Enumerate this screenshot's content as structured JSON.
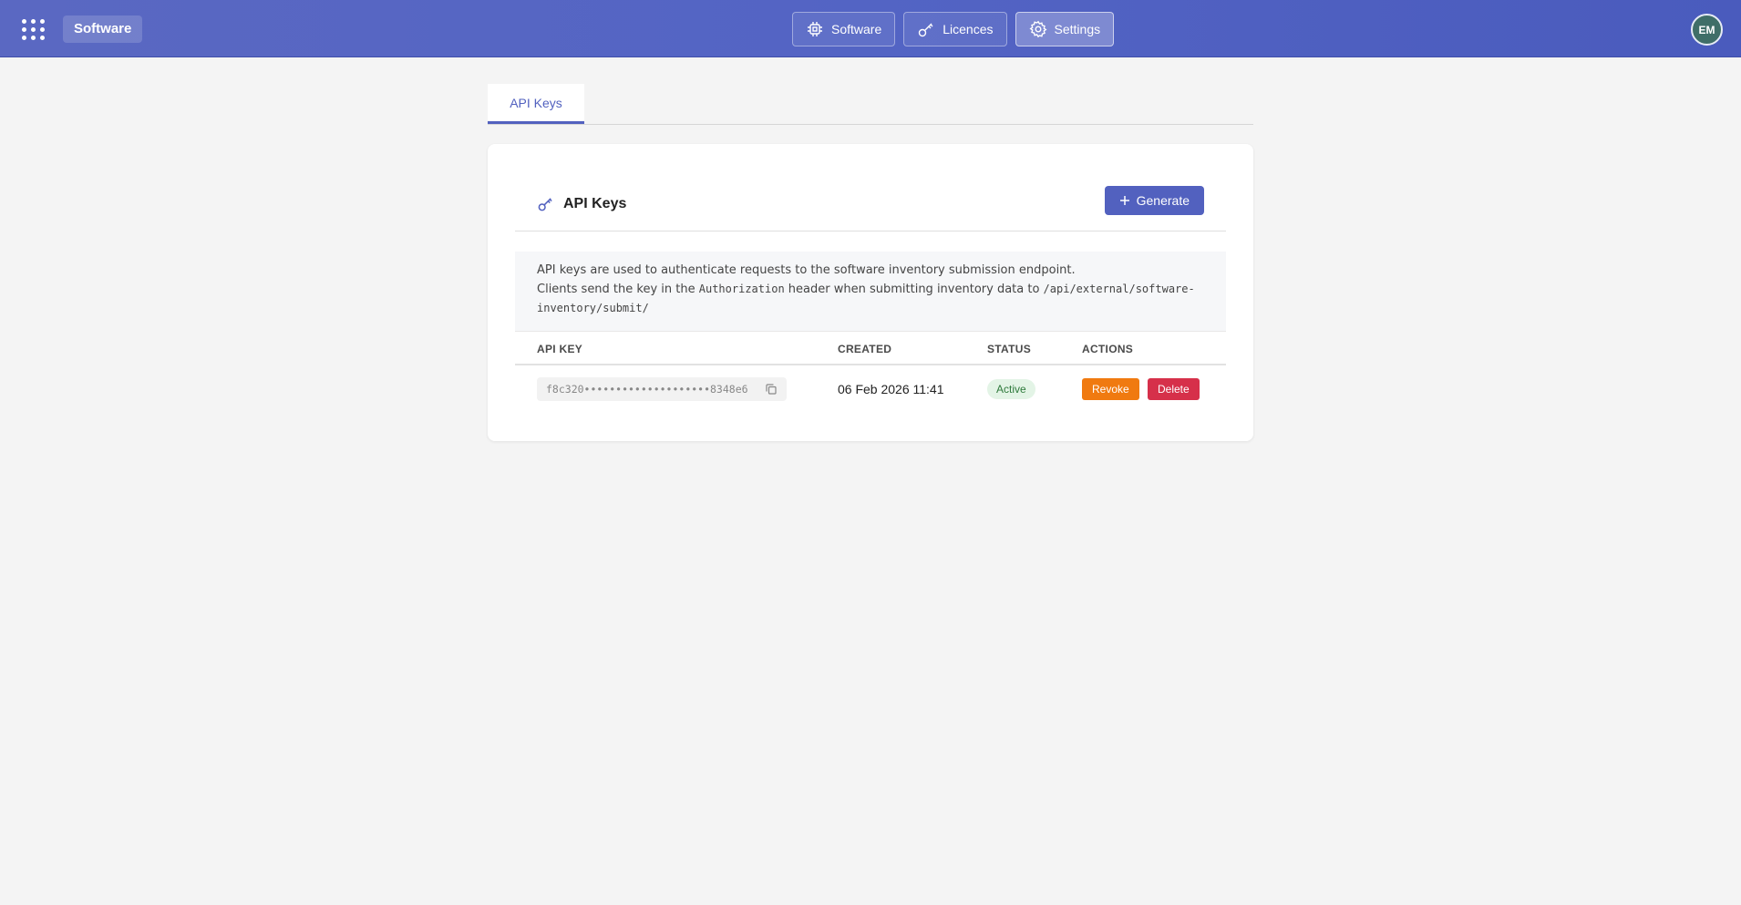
{
  "header": {
    "brand": "Software",
    "nav": [
      {
        "label": "Software",
        "icon": "chip-icon"
      },
      {
        "label": "Licences",
        "icon": "key-icon"
      },
      {
        "label": "Settings",
        "icon": "gear-icon",
        "active": true
      }
    ],
    "avatar_initials": "EM"
  },
  "tabs": [
    {
      "label": "API Keys",
      "active": true
    }
  ],
  "card": {
    "title": "API Keys",
    "generate_label": "Generate",
    "info_line1": "API keys are used to authenticate requests to the software inventory submission endpoint.",
    "info_line2_a": "Clients send the key in the ",
    "info_line2_code": "Authorization",
    "info_line2_b": " header when submitting inventory data to ",
    "info_line2_path": "/api/external/software-inventory/submit/",
    "columns": [
      "API KEY",
      "CREATED",
      "STATUS",
      "ACTIONS"
    ],
    "rows": [
      {
        "key": "f8c320••••••••••••••••••••8348e6",
        "created": "06 Feb 2026 11:41",
        "status": "Active",
        "revoke_label": "Revoke",
        "delete_label": "Delete"
      }
    ]
  },
  "colors": {
    "primary": "#5261bf",
    "revoke": "#f07a10",
    "delete": "#d6304a",
    "status_active_bg": "#e3f4e6",
    "status_active_fg": "#2f7a3c"
  }
}
